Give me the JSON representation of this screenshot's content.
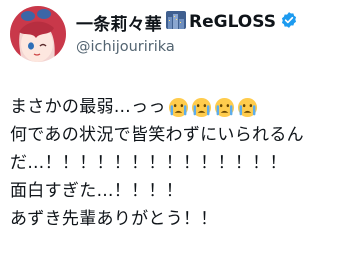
{
  "post": {
    "author": {
      "display_name": "一条莉々華",
      "group_name": "ReGLOSS",
      "handle": "@ichijouririka",
      "verified": true,
      "name_emoji": "city-night-icon"
    },
    "text_lines": [
      "まさかの最弱…っっ",
      "何であの状況で皆笑わずにいられるん",
      "だ…！！！！！！！！！！！！！！",
      "面白すぎた…！！！！",
      "あずき先輩ありがとう！！"
    ],
    "line1_emoji": [
      "crying-face-icon",
      "crying-face-icon",
      "crying-face-icon",
      "crying-face-icon"
    ],
    "colors": {
      "verified_badge": "#1d9bf0",
      "handle_text": "#536471",
      "avatar_hair": "#c9384a"
    }
  }
}
